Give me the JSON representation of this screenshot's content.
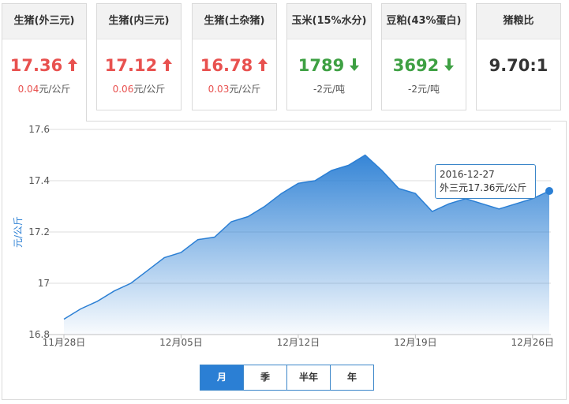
{
  "cards": [
    {
      "title": "生猪(外三元)",
      "price": "17.36",
      "direction": "up",
      "change_value": "0.04",
      "change_unit": "元/公斤"
    },
    {
      "title": "生猪(内三元)",
      "price": "17.12",
      "direction": "up",
      "change_value": "0.06",
      "change_unit": "元/公斤"
    },
    {
      "title": "生猪(土杂猪)",
      "price": "16.78",
      "direction": "up",
      "change_value": "0.03",
      "change_unit": "元/公斤"
    },
    {
      "title": "玉米(15%水分)",
      "price": "1789",
      "direction": "down",
      "change_value": "-2",
      "change_unit": "元/吨"
    },
    {
      "title": "豆粕(43%蛋白)",
      "price": "3692",
      "direction": "down",
      "change_value": "-2",
      "change_unit": "元/吨"
    },
    {
      "title": "猪粮比",
      "price": "9.70:1",
      "direction": "none",
      "change_value": "",
      "change_unit": ""
    }
  ],
  "colors": {
    "up": "#e8514f",
    "down": "#3ea043",
    "line": "#2b7fd4",
    "accent": "#2b7fd4"
  },
  "tabs": [
    {
      "label": "月",
      "selected": true
    },
    {
      "label": "季",
      "selected": false
    },
    {
      "label": "半年",
      "selected": false
    },
    {
      "label": "年",
      "selected": false
    }
  ],
  "tooltip": {
    "date": "2016-12-27",
    "text": "外三元17.36元/公斤"
  },
  "chart_data": {
    "type": "area",
    "title": "",
    "xlabel": "",
    "ylabel": "元/公斤",
    "ylim": [
      16.8,
      17.6
    ],
    "yticks": [
      "16.8",
      "17",
      "17.2",
      "17.4",
      "17.6"
    ],
    "xticks": [
      "11月28日",
      "12月05日",
      "12月12日",
      "12月19日",
      "12月26日"
    ],
    "grid": true,
    "series": [
      {
        "x": [
          "2016-11-28",
          "2016-11-29",
          "2016-11-30",
          "2016-12-01",
          "2016-12-02",
          "2016-12-03",
          "2016-12-04",
          "2016-12-05",
          "2016-12-06",
          "2016-12-07",
          "2016-12-08",
          "2016-12-09",
          "2016-12-10",
          "2016-12-11",
          "2016-12-12",
          "2016-12-13",
          "2016-12-14",
          "2016-12-15",
          "2016-12-16",
          "2016-12-17",
          "2016-12-18",
          "2016-12-19",
          "2016-12-20",
          "2016-12-21",
          "2016-12-22",
          "2016-12-23",
          "2016-12-24",
          "2016-12-25",
          "2016-12-26",
          "2016-12-27"
        ],
        "values": [
          16.86,
          16.9,
          16.93,
          16.97,
          17.0,
          17.05,
          17.1,
          17.12,
          17.17,
          17.18,
          17.24,
          17.26,
          17.3,
          17.35,
          17.39,
          17.4,
          17.44,
          17.46,
          17.5,
          17.44,
          17.37,
          17.35,
          17.28,
          17.31,
          17.33,
          17.31,
          17.29,
          17.31,
          17.33,
          17.36
        ]
      }
    ]
  }
}
